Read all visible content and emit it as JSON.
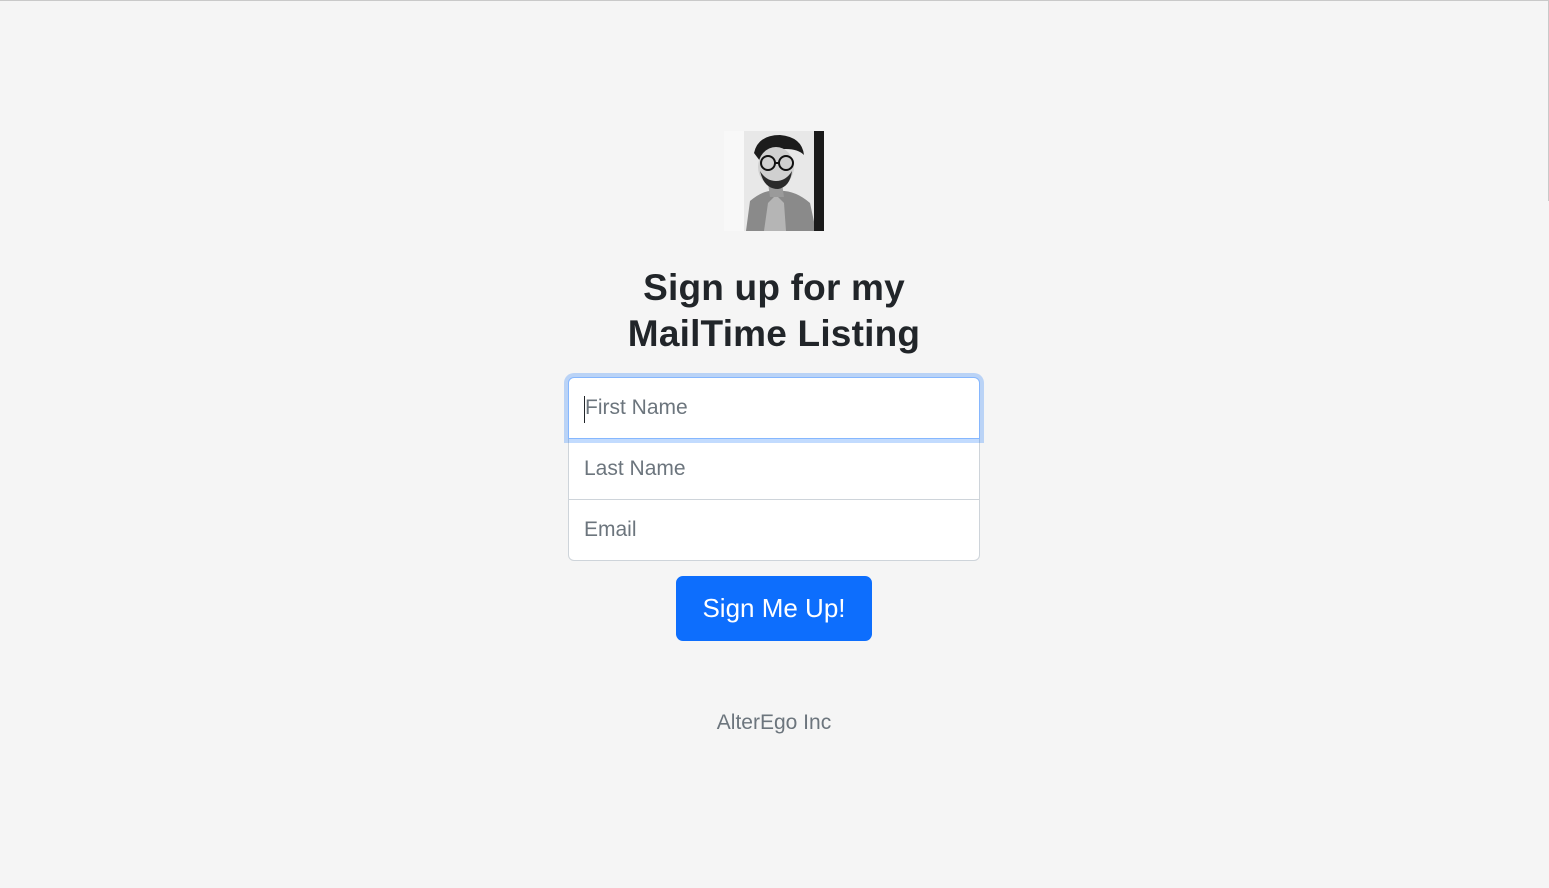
{
  "avatar": {
    "alt": "profile photo"
  },
  "heading": {
    "line1": "Sign up for my",
    "line2": "MailTime Listing"
  },
  "form": {
    "first_name_placeholder": "First Name",
    "last_name_placeholder": "Last Name",
    "email_placeholder": "Email",
    "submit_label": "Sign Me Up!"
  },
  "footer": {
    "text": "AlterEgo Inc"
  },
  "colors": {
    "background": "#f5f5f5",
    "primary": "#0d6efd",
    "focus_ring": "#86b7fe",
    "placeholder": "#6c757d"
  }
}
